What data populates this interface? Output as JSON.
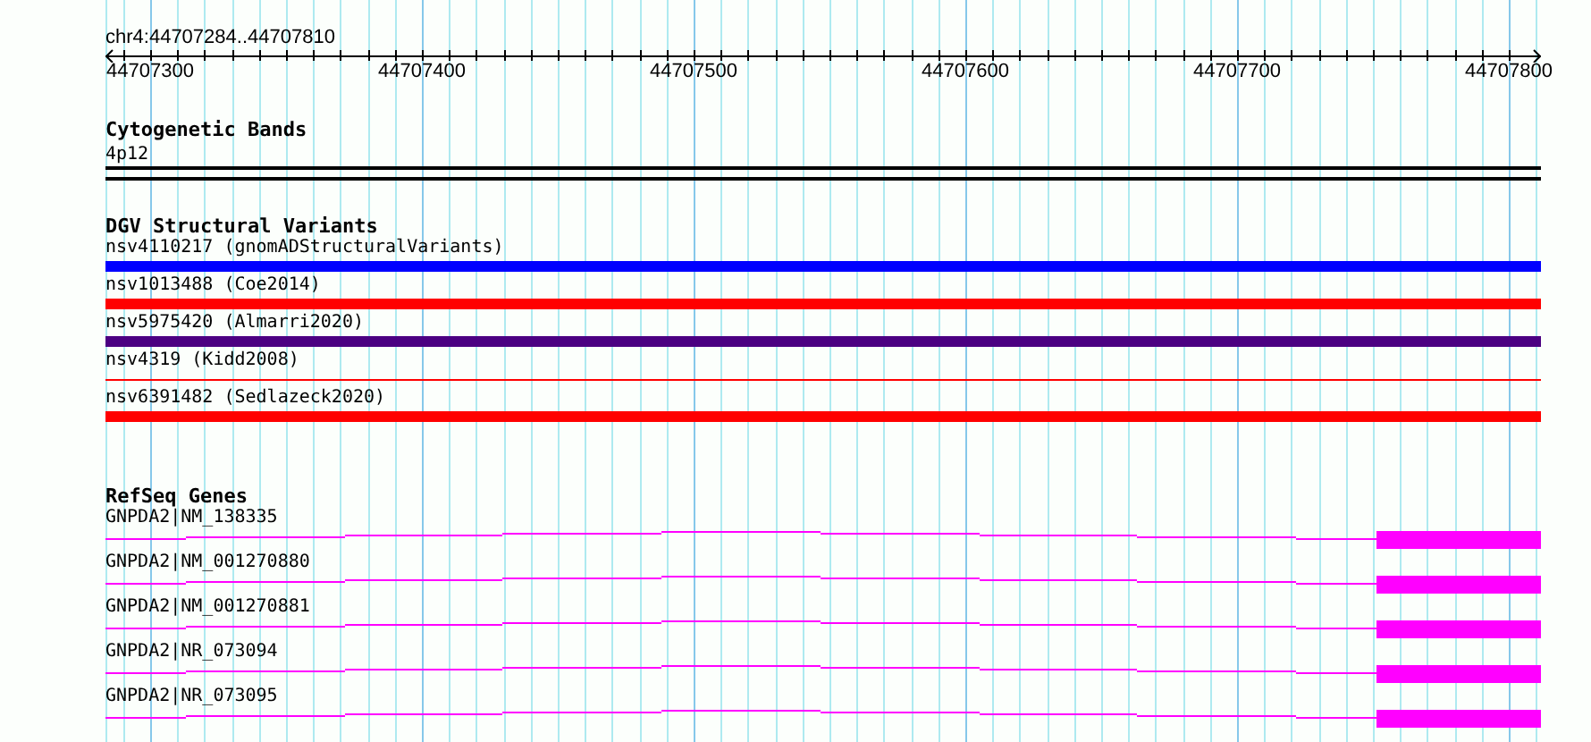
{
  "location": "chr4:44707284..44707810",
  "ruler": {
    "ticks": [
      "44707300",
      "44707400",
      "44707500",
      "44707600",
      "44707700",
      "44707800"
    ]
  },
  "tracks": [
    {
      "kind": "cytoband",
      "title": "Cytogenetic Bands",
      "features": [
        {
          "label": "4p12"
        }
      ]
    },
    {
      "kind": "variants",
      "title": "DGV Structural Variants",
      "features": [
        {
          "label": "nsv4110217 (gnomADStructuralVariants)",
          "color": "#0000ff",
          "kind": "bar"
        },
        {
          "label": "nsv1013488 (Coe2014)",
          "color": "#ff0000",
          "kind": "bar"
        },
        {
          "label": "nsv5975420 (Almarri2020)",
          "color": "#4b0082",
          "kind": "bar"
        },
        {
          "label": "nsv4319 (Kidd2008)",
          "color": "#ff0000",
          "kind": "line"
        },
        {
          "label": "nsv6391482 (Sedlazeck2020)",
          "color": "#ff0000",
          "kind": "bar"
        }
      ]
    },
    {
      "kind": "genes",
      "title": "RefSeq Genes",
      "features": [
        {
          "label": "GNPDA2|NM_138335"
        },
        {
          "label": "GNPDA2|NM_001270880"
        },
        {
          "label": "GNPDA2|NM_001270881"
        },
        {
          "label": "GNPDA2|NR_073094"
        },
        {
          "label": "GNPDA2|NR_073095"
        }
      ]
    }
  ]
}
